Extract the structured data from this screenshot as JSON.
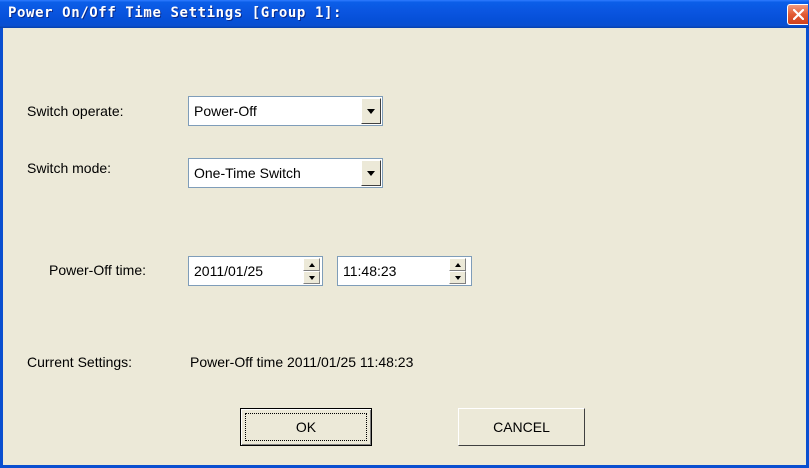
{
  "window": {
    "title": "Power On/Off Time Settings [Group 1]:"
  },
  "form": {
    "switch_operate": {
      "label": "Switch operate:",
      "value": "Power-Off"
    },
    "switch_mode": {
      "label": "Switch  mode:",
      "value": "One-Time Switch"
    },
    "power_off_time": {
      "label": "Power-Off time:",
      "date": "2011/01/25",
      "time": "11:48:23"
    },
    "current_settings": {
      "label": "Current Settings:",
      "value": "Power-Off time 2011/01/25 11:48:23"
    }
  },
  "buttons": {
    "ok": "OK",
    "cancel": "CANCEL"
  },
  "icons": {
    "close": "close-icon",
    "dropdown": "chevron-down-icon",
    "spin_up": "arrow-up-icon",
    "spin_down": "arrow-down-icon"
  },
  "colors": {
    "titlebar": "#0a55e0",
    "dialog_background": "#ece9d8",
    "close_button": "#e25a32"
  }
}
